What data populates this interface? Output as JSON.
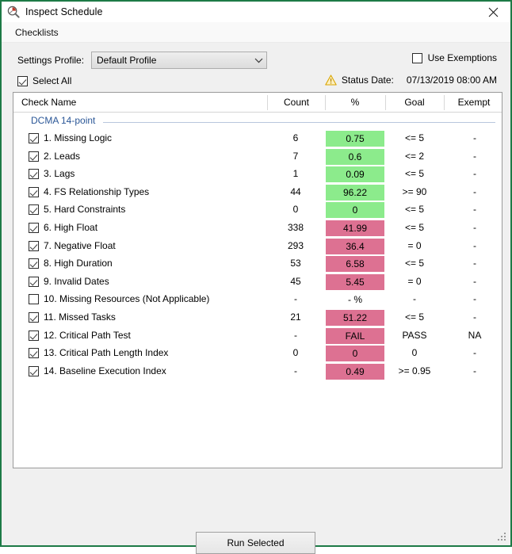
{
  "window": {
    "title": "Inspect Schedule",
    "title_icon": "magnifier-schedule-icon",
    "close_icon": "close-icon",
    "border_color": "#1d7a46"
  },
  "menubar": {
    "items": [
      {
        "label": "Checklists"
      }
    ]
  },
  "toolbar": {
    "profile_label": "Settings Profile:",
    "profile_value": "Default Profile",
    "profile_arrow_icon": "chevron-down-icon",
    "use_exemptions_label": "Use Exemptions",
    "use_exemptions_checked": false,
    "select_all_label": "Select All",
    "select_all_checked": true,
    "status_warning_icon": "warning-triangle-icon",
    "status_date_label": "Status Date:",
    "status_date_value": "07/13/2019 08:00 AM"
  },
  "list": {
    "columns": [
      "Check Name",
      "Count",
      "%",
      "Goal",
      "Exempt"
    ],
    "group_label": "DCMA 14-point",
    "rows": [
      {
        "checked": true,
        "name": "1.  Missing Logic",
        "count": "6",
        "pct": "0.75",
        "pct_color": "green",
        "goal": "<= 5",
        "exempt": "-"
      },
      {
        "checked": true,
        "name": "2.  Leads",
        "count": "7",
        "pct": "0.6",
        "pct_color": "green",
        "goal": "<= 2",
        "exempt": "-"
      },
      {
        "checked": true,
        "name": "3.  Lags",
        "count": "1",
        "pct": "0.09",
        "pct_color": "green",
        "goal": "<= 5",
        "exempt": "-"
      },
      {
        "checked": true,
        "name": "4.  FS Relationship Types",
        "count": "44",
        "pct": "96.22",
        "pct_color": "green",
        "goal": ">= 90",
        "exempt": "-"
      },
      {
        "checked": true,
        "name": "5.  Hard Constraints",
        "count": "0",
        "pct": "0",
        "pct_color": "green",
        "goal": "<= 5",
        "exempt": "-"
      },
      {
        "checked": true,
        "name": "6.  High Float",
        "count": "338",
        "pct": "41.99",
        "pct_color": "pink",
        "goal": "<= 5",
        "exempt": "-"
      },
      {
        "checked": true,
        "name": "7.  Negative Float",
        "count": "293",
        "pct": "36.4",
        "pct_color": "pink",
        "goal": "= 0",
        "exempt": "-"
      },
      {
        "checked": true,
        "name": "8.  High Duration",
        "count": "53",
        "pct": "6.58",
        "pct_color": "pink",
        "goal": "<= 5",
        "exempt": "-"
      },
      {
        "checked": true,
        "name": "9.  Invalid Dates",
        "count": "45",
        "pct": "5.45",
        "pct_color": "pink",
        "goal": "= 0",
        "exempt": "-"
      },
      {
        "checked": false,
        "name": "10. Missing Resources (Not Applicable)",
        "count": "-",
        "pct": "- %",
        "pct_color": "none",
        "goal": "-",
        "exempt": "-"
      },
      {
        "checked": true,
        "name": "11. Missed Tasks",
        "count": "21",
        "pct": "51.22",
        "pct_color": "pink",
        "goal": "<= 5",
        "exempt": "-"
      },
      {
        "checked": true,
        "name": "12. Critical Path Test",
        "count": "-",
        "pct": "FAIL",
        "pct_color": "pink",
        "goal": "PASS",
        "exempt": "NA"
      },
      {
        "checked": true,
        "name": "13. Critical Path Length Index",
        "count": "0",
        "pct": "0",
        "pct_color": "pink",
        "goal": "0",
        "exempt": "-"
      },
      {
        "checked": true,
        "name": "14. Baseline Execution Index",
        "count": "-",
        "pct": "0.49",
        "pct_color": "pink",
        "goal": ">= 0.95",
        "exempt": "-"
      }
    ]
  },
  "footer": {
    "run_button_label": "Run Selected"
  },
  "colors": {
    "pass_green": "#8ceb8c",
    "fail_pink": "#dd7192",
    "group_blue": "#2b5797",
    "window_border": "#1d7a46"
  }
}
